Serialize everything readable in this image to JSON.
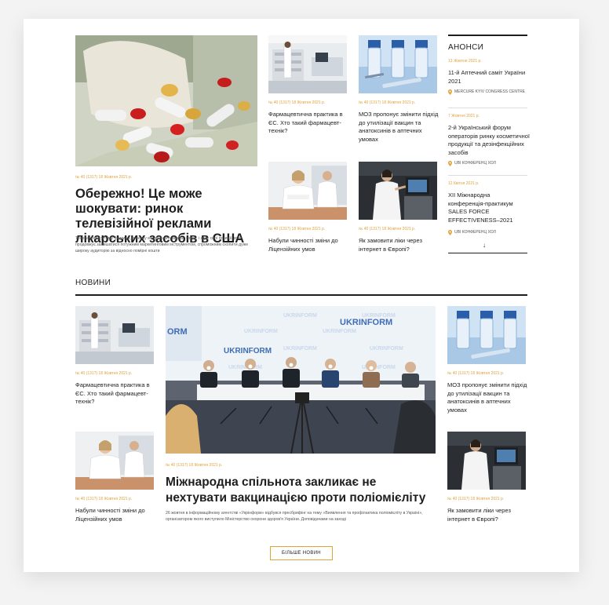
{
  "top": {
    "hero": {
      "meta": "№ 40 (1317) 18 Жовтня 2021 р.",
      "title": "Обережно! Це може шокувати: ринок телевізійної реклами лікарських засобів в США",
      "excerpt": "Телебачення у тому форматі, в якому ми до нього звикли, може, і здає свої позиції, втім продовжує залишатися потужним маркетинговим інструментом, спроможним охопити дуже широку аудиторію за відносно помірні кошти"
    },
    "cards": [
      {
        "meta": "№ 40 (1317) 18 Жовтня 2021 р.",
        "title": "Фармацевтична практика в ЄС. Хто такий фармацевт-технік?"
      },
      {
        "meta": "№ 40 (1317) 18 Жовтня 2021 р.",
        "title": "МОЗ пропонує змінити підхід до утилізації вакцин та анатоксинів в аптечних умовах"
      },
      {
        "meta": "№ 40 (1317) 18 Жовтня 2021 р.",
        "title": "Набули чинності зміни до Ліцензійних умов"
      },
      {
        "meta": "№ 40 (1317) 18 Жовтня 2021 р.",
        "title": "Як замовити ліки через інтернет в Європі?"
      }
    ]
  },
  "announcements": {
    "heading": "АНОНСИ",
    "items": [
      {
        "date": "13 Жовтня 2021 р.",
        "title": "11-й Аптечний саміт України 2021",
        "location": "MERCURE KYIV CONGRESS CENTRE"
      },
      {
        "date": "7 Жовтня 2021 р.",
        "title": "2-й Український форум операторів ринку косметичної продукції та дезінфекційних засобів",
        "location": "UBI КОНФЕРЕНЦ ХОЛ"
      },
      {
        "date": "12 Квітня 2021 р.",
        "title": "XII Міжнародна конференція-практикум SALES FORCE EFFECTIVENESS–2021",
        "location": "UBI КОНФЕРЕНЦ ХОЛ"
      }
    ],
    "scroll_arrow": "↓"
  },
  "news": {
    "heading": "НОВИНИ",
    "left": [
      {
        "meta": "№ 40 (1317) 18 Жовтня 2021 р.",
        "title": "Фармацевтична практика в ЄС. Хто такий фармацевт-технік?"
      },
      {
        "meta": "№ 40 (1317) 18 Жовтня 2021 р.",
        "title": "Набули чинності зміни до Ліцензійних умов"
      }
    ],
    "center": {
      "banner_text": "UKRINFORM",
      "banner_side": "ORM",
      "meta": "№ 40 (1317) 18 Жовтня 2021 р.",
      "title": "Міжнародна спільнота закликає не нехтувати вакцинацією проти поліомієліту",
      "excerpt": "26 жовтня в інформаційному агентстві «Укрінформ» відбувся пресбрифінг на тему «Виявлення та профілактика поліомієліту в Україні», організатором якого виступило Міністерство охорони здоров'я України. Доповідачами на заході"
    },
    "right": [
      {
        "meta": "№ 40 (1317) 18 Жовтня 2021 р.",
        "title": "МОЗ пропонує змінити підхід до утилізації вакцин та анатоксинів в аптечних умовах"
      },
      {
        "meta": "№ 40 (1317) 18 Жовтня 2021 р.",
        "title": "Як замовити ліки через інтернет в Європі?"
      }
    ],
    "more_label": "БІЛЬШЕ НОВИН"
  },
  "colors": {
    "accent": "#e0a23b",
    "text": "#1e1e1e",
    "rule": "#1e1e1e"
  },
  "icons": {
    "location": "map-pin-icon",
    "scroll": "arrow-down-icon"
  }
}
